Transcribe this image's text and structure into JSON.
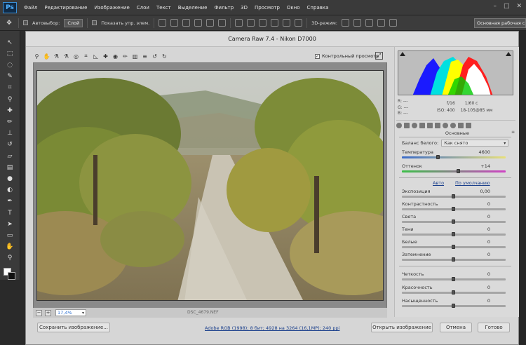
{
  "ps": {
    "logo": "Ps",
    "menu": [
      "Файл",
      "Редактирование",
      "Изображение",
      "Слои",
      "Текст",
      "Выделение",
      "Фильтр",
      "3D",
      "Просмотр",
      "Окно",
      "Справка"
    ],
    "window_controls": [
      "–",
      "□",
      "✕"
    ],
    "options": {
      "autoselect_label": "Автовыбор:",
      "autoselect_value": "Слой",
      "show_controls_label": "Показать упр. элем.",
      "mode_3d": "3D-режим:",
      "workspace": "Основная рабочая среда"
    }
  },
  "dialog": {
    "title": "Camera Raw 7.4  -  Nikon D7000",
    "preview_label": "Контрольный просмотр",
    "zoom": "17,4%",
    "filename": "DSC_4679.NEF",
    "workflow": "Adobe RGB (1998); 8 бит; 4928 на 3264 (16,1МР); 240 ppi",
    "buttons": {
      "save": "Сохранить изображение...",
      "open": "Открыть изображение",
      "cancel": "Отмена",
      "done": "Готово"
    }
  },
  "info": {
    "rgb": [
      "R:  ---",
      "G:  ---",
      "B:  ---"
    ],
    "aperture": "f/16",
    "shutter": "1/60 с",
    "iso": "ISO: 400",
    "lens": "18-105@85 мм"
  },
  "panel": {
    "title": "Основные",
    "wb_label": "Баланс белого:",
    "wb_value": "Как снято",
    "auto": "Авто",
    "default": "По умолчанию",
    "sliders": [
      {
        "label": "Температура",
        "value": "4600",
        "pos": 0.35
      },
      {
        "label": "Оттенок",
        "value": "+14",
        "pos": 0.55
      },
      {
        "label": "Экспозиция",
        "value": "0,00",
        "pos": 0.5
      },
      {
        "label": "Контрастность",
        "value": "0",
        "pos": 0.5
      },
      {
        "label": "Света",
        "value": "0",
        "pos": 0.5
      },
      {
        "label": "Тени",
        "value": "0",
        "pos": 0.5
      },
      {
        "label": "Белые",
        "value": "0",
        "pos": 0.5
      },
      {
        "label": "Затемнение",
        "value": "0",
        "pos": 0.5
      },
      {
        "label": "Четкость",
        "value": "0",
        "pos": 0.5
      },
      {
        "label": "Красочность",
        "value": "0",
        "pos": 0.5
      },
      {
        "label": "Насыщенность",
        "value": "0",
        "pos": 0.5
      }
    ]
  }
}
